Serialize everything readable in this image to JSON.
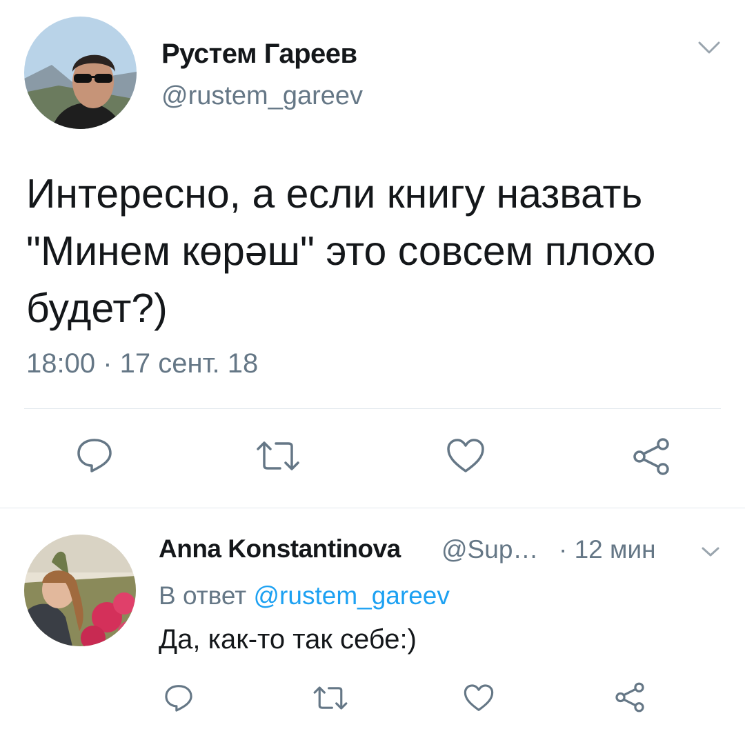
{
  "tweet": {
    "author_name": "Рустем Гареев",
    "author_handle": "@rustem_gareev",
    "text": "Интересно, а если книгу назвать \"Минем көрәш\" это совсем плохо будет?)",
    "timestamp": "18:00 · 17 сент. 18"
  },
  "reply": {
    "author_name": "Anna Konstantinova",
    "author_handle": "@Sup…",
    "time": "· 12 мин",
    "reply_to_prefix": "В ответ",
    "reply_to_handle": "@rustem_gareev",
    "text": "Да, как-то так себе:)"
  },
  "icons": {
    "reply": "reply-icon",
    "retweet": "retweet-icon",
    "like": "heart-icon",
    "share": "share-icon",
    "menu": "chevron-down-icon"
  },
  "colors": {
    "text": "#14171a",
    "secondary": "#657786",
    "link": "#1da1f2",
    "icon": "#657786",
    "divider": "#e1e8ed"
  }
}
